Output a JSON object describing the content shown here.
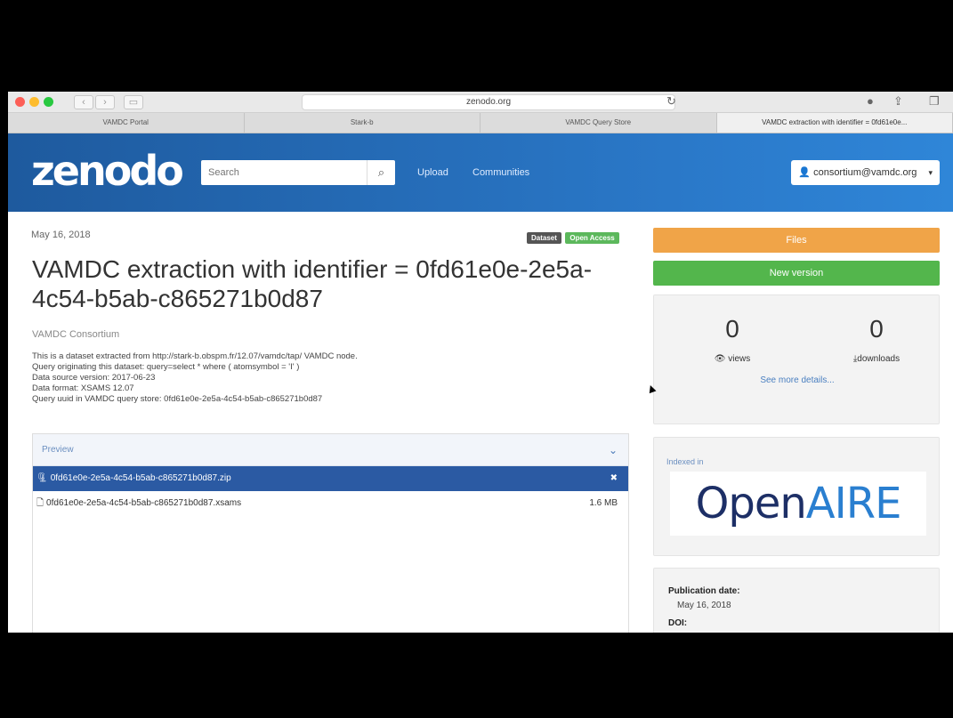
{
  "browser": {
    "address": "zenodo.org",
    "tabs": [
      {
        "label": "VAMDC Portal",
        "active": false
      },
      {
        "label": "Stark-b",
        "active": false
      },
      {
        "label": "VAMDC Query Store",
        "active": false
      },
      {
        "label": "VAMDC extraction with identifier = 0fd61e0e...",
        "active": true
      }
    ]
  },
  "header": {
    "logo": "zenodo",
    "search_placeholder": "Search",
    "nav": {
      "upload": "Upload",
      "communities": "Communities"
    },
    "user": "consortium@vamdc.org"
  },
  "record": {
    "date": "May 16, 2018",
    "badges": {
      "type": "Dataset",
      "access": "Open Access"
    },
    "title": "VAMDC extraction with identifier = 0fd61e0e-2e5a-4c54-b5ab-c865271b0d87",
    "author": "VAMDC Consortium",
    "description": [
      "This is a dataset extracted from http://stark-b.obspm.fr/12.07/vamdc/tap/ VAMDC node.",
      "Query originating this dataset: query=select * where ( atomsymbol = 'I' )",
      "Data source version: 2017-06-23",
      "Data format: XSAMS 12.07",
      "Query uuid in VAMDC query store: 0fd61e0e-2e5a-4c54-b5ab-c865271b0d87"
    ]
  },
  "preview": {
    "label": "Preview",
    "files": [
      {
        "name": "0fd61e0e-2e5a-4c54-b5ab-c865271b0d87.zip",
        "size": ""
      },
      {
        "name": "0fd61e0e-2e5a-4c54-b5ab-c865271b0d87.xsams",
        "size": "1.6 MB"
      }
    ]
  },
  "sidebar": {
    "files_button": "Files",
    "new_version_button": "New version",
    "views": {
      "value": "0",
      "label": "views"
    },
    "downloads": {
      "value": "0",
      "label": "downloads"
    },
    "see_more": "See more details...",
    "indexed_in": "Indexed in",
    "openaire": {
      "part1": "Open",
      "part2": "AIRE"
    },
    "publication_date_label": "Publication date:",
    "publication_date": "May 16, 2018",
    "doi_label": "DOI:"
  },
  "colors": {
    "header": "#2a78c8",
    "files_button": "#f0a448",
    "new_version_button": "#53b64c",
    "selected_row": "#2b5aa3"
  }
}
